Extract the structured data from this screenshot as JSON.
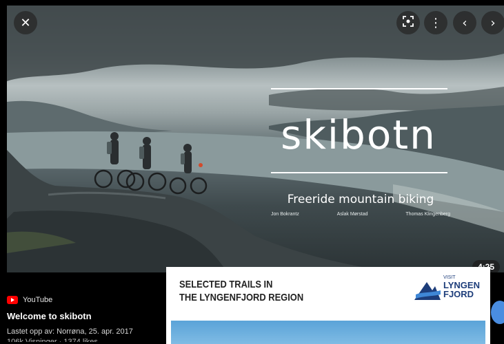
{
  "viewer": {
    "close_icon": "close-icon",
    "lens_icon": "lens-icon",
    "more_icon": "more-vertical-icon",
    "prev_icon": "chevron-left-icon",
    "next_icon": "chevron-right-icon"
  },
  "video": {
    "title_word": "skibotn",
    "subtitle": "Freeride mountain biking",
    "names": [
      "Jon Bokrantz",
      "Aslak Mørstad",
      "Thomas Klingenberg"
    ],
    "duration": "4:25"
  },
  "info": {
    "source": "YouTube",
    "title": "Welcome to skibotn",
    "uploaded": "Lastet opp av: Norrøna, 25. apr. 2017",
    "views": "106k Visninger · 1374 likes"
  },
  "card": {
    "heading_line1": "SELECTED TRAILS IN",
    "heading_line2": "THE LYNGENFJORD REGION",
    "logo_small": "VISIT",
    "logo_line1": "LYNGEN",
    "logo_line2": "FJORD"
  },
  "colors": {
    "youtube_red": "#ff0000",
    "logo_blue": "#1d3d7a",
    "accent_blue": "#4a8de0"
  }
}
